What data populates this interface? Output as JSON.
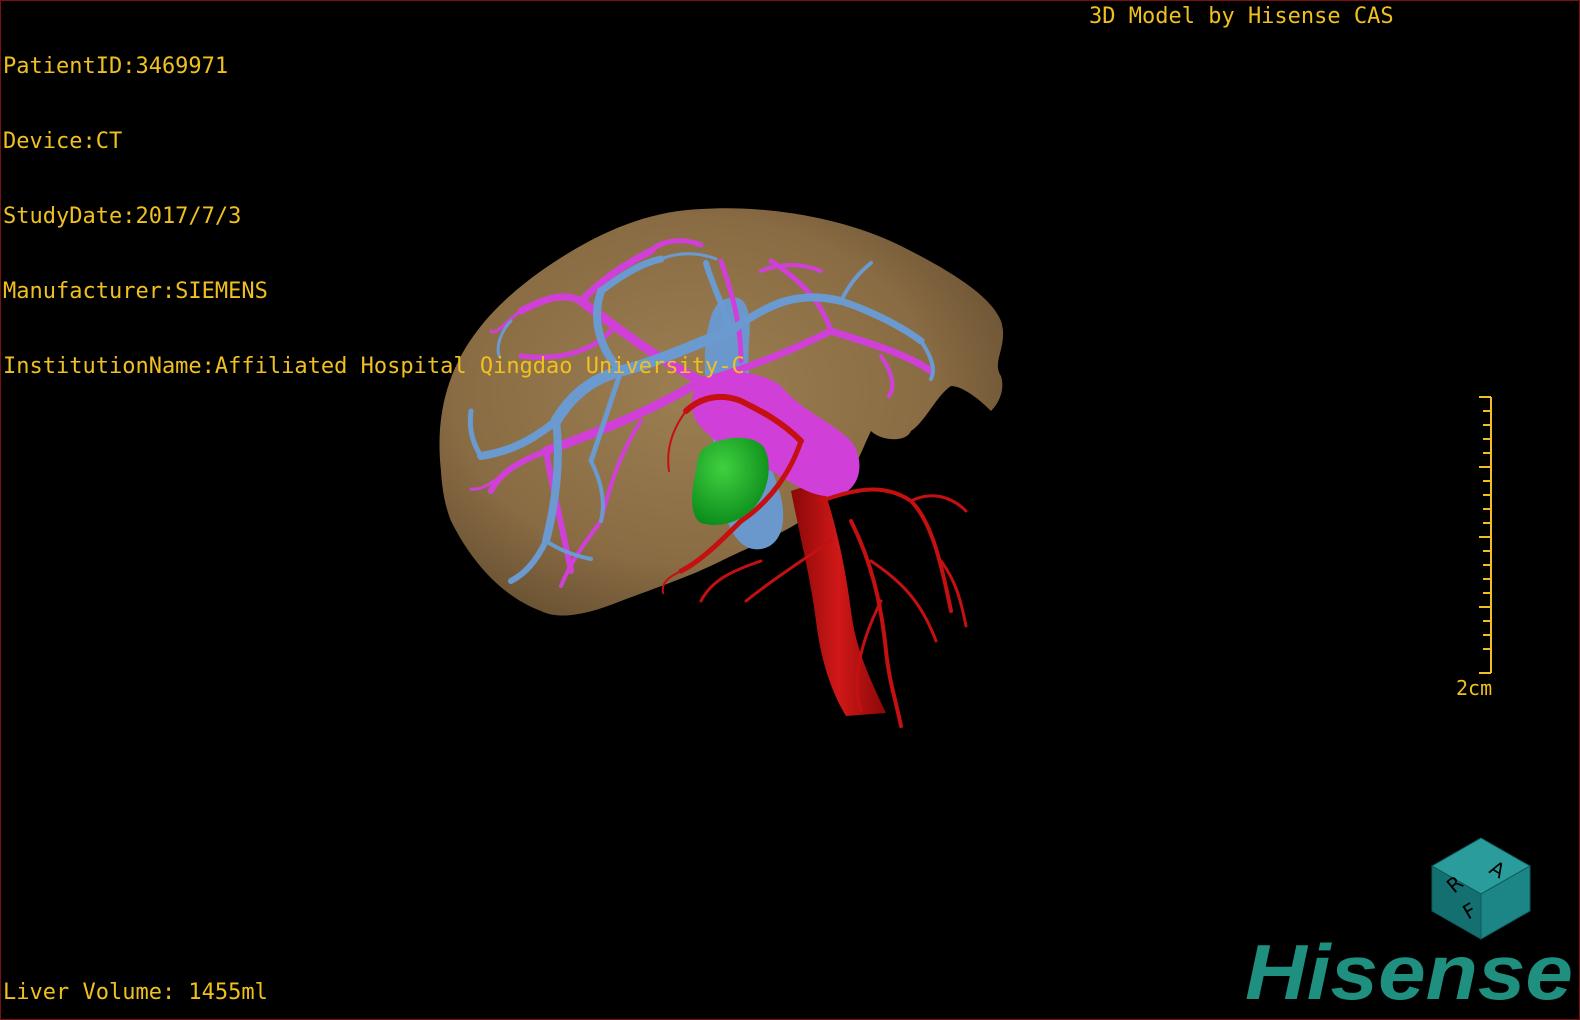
{
  "patient_info": {
    "patient_id": "PatientID:3469971",
    "device": "Device:CT",
    "study_date": "StudyDate:2017/7/3",
    "manufacturer": "Manufacturer:SIEMENS",
    "institution": "InstitutionName:Affiliated Hospital Qingdao University-C"
  },
  "model_credit": "3D Model by Hisense CAS",
  "scale_bar": {
    "label": "2cm"
  },
  "liver_volume": "Liver Volume: 1455ml",
  "orientation_cube": {
    "faces": [
      "R",
      "A",
      "F"
    ]
  },
  "brand": {
    "logo_text": "Hisense",
    "color": "#1f8f7f"
  },
  "colors": {
    "overlay_text": "#f0c020",
    "liver": "#8c7048",
    "portal_vein": "#6a9ad0",
    "hepatic_vein": "#d040d8",
    "artery": "#c41010",
    "tumor": "#10a020",
    "cube": "#1a7c7c"
  }
}
